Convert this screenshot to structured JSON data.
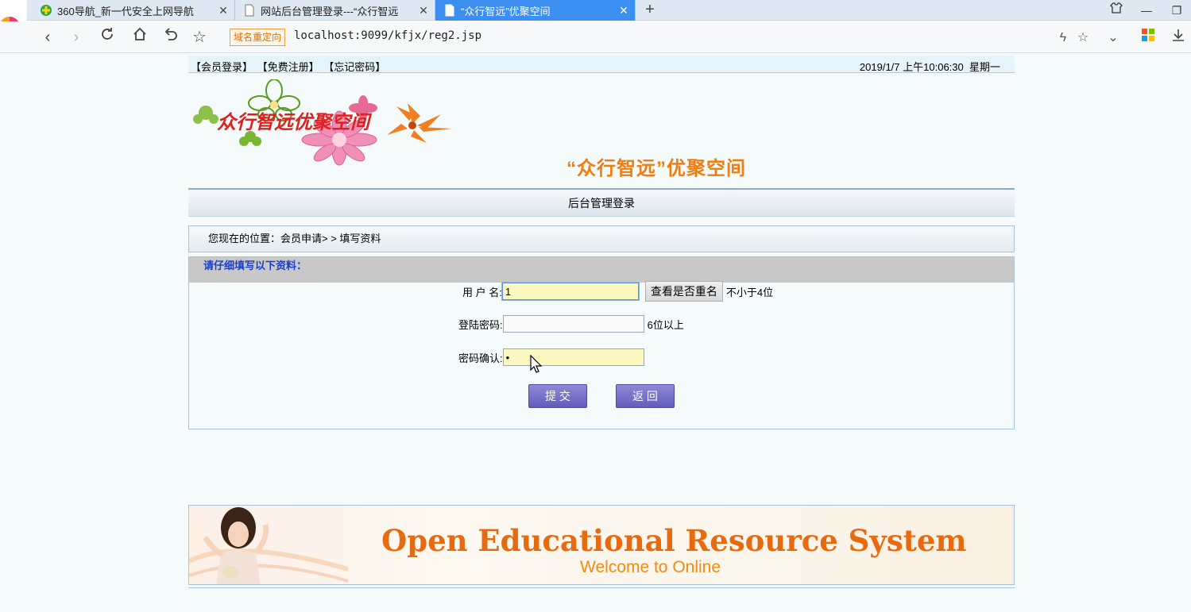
{
  "browser": {
    "tabs": [
      {
        "title": "360导航_新一代安全上网导航",
        "active": false
      },
      {
        "title": "网站后台管理登录---“众行智远",
        "active": false
      },
      {
        "title": "“众行智远”优聚空间",
        "active": true
      }
    ],
    "redirect_badge": "域名重定向",
    "url": "localhost:9099/kfjx/reg2.jsp",
    "icons": [
      "back-icon",
      "forward-icon",
      "refresh-icon",
      "home-icon",
      "undo-icon",
      "star-icon",
      "lightning-icon",
      "chevron-down-icon",
      "apps-icon",
      "download-icon"
    ]
  },
  "header": {
    "links": [
      "【会员登录】",
      "【免费注册】",
      "【忘记密码】"
    ],
    "datetime": "2019/1/7 上午10:06:30",
    "weekday": "星期一"
  },
  "banner": {
    "logo_text": "众行智远优聚空间",
    "slogan": "“众行智远”优聚空间"
  },
  "admin_title": "后台管理登录",
  "breadcrumb": "您现在的位置：会员申请> > 填写资料",
  "form": {
    "heading": "请仔细填写以下资料：",
    "username_label": "用 户 名:",
    "username_value": "1",
    "check_button": "查看是否重名",
    "username_hint": "不小于4位",
    "password_label": "登陆密码:",
    "password_value": "",
    "password_hint": "6位以上",
    "confirm_label": "密码确认:",
    "confirm_value": "•",
    "submit_label": "提 交",
    "back_label": "返 回"
  },
  "footer": {
    "title": "Open Educational Resource System",
    "subtitle": "Welcome to Online"
  },
  "colors": {
    "accent_tab": "#3c8ff0",
    "slogan": "#f07d10",
    "form_heading": "#1a3fcc",
    "button": "#6f6bc8"
  }
}
